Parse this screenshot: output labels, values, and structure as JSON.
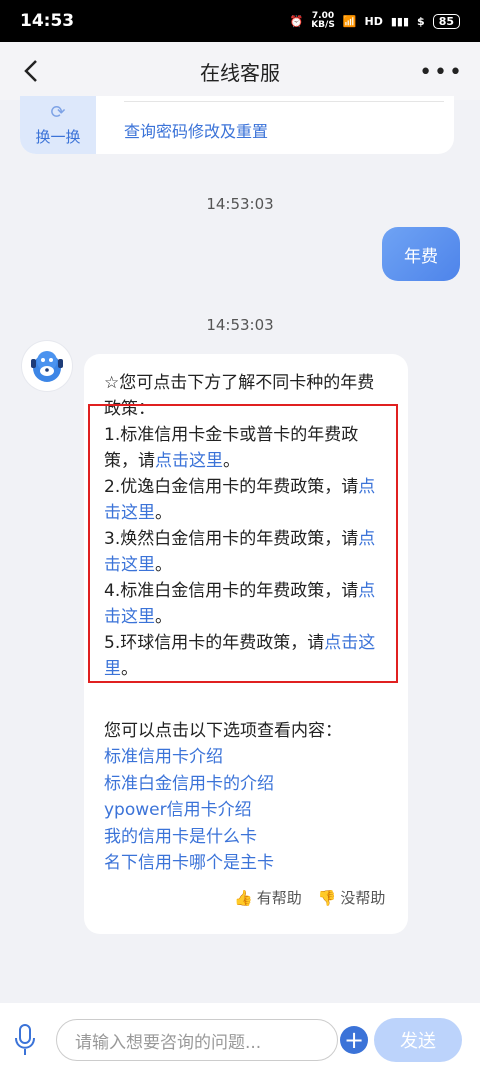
{
  "status": {
    "time": "14:53",
    "net_speed_top": "7.00",
    "net_speed_bottom": "KB/S",
    "battery": "85"
  },
  "nav": {
    "title": "在线客服",
    "more": "•••"
  },
  "top_card": {
    "swap_label": "换一换",
    "link": "查询密码修改及重置"
  },
  "times": [
    "14:53:03",
    "14:53:03"
  ],
  "user_msg": "年费",
  "bot": {
    "lines": [
      [
        "☆您可点击下方了解不同卡种的年费"
      ],
      [
        "政策："
      ],
      [
        "1.标准信用卡金卡或普卡的年费政"
      ],
      [
        "策，请",
        "点击这里",
        "。"
      ],
      [
        "2.优逸白金信用卡的年费政策，请",
        "点"
      ],
      [
        "击这里",
        "。"
      ],
      [
        "3.焕然白金信用卡的年费政策，请",
        "点"
      ],
      [
        "击这里",
        "。"
      ],
      [
        "4.标准白金信用卡的年费政策，请",
        "点"
      ],
      [
        "击这里",
        "。"
      ],
      [
        "5.环球信用卡的年费政策，请",
        "点击这"
      ],
      [
        "里",
        "。"
      ]
    ],
    "options_title": "您可以点击以下选项查看内容：",
    "options": [
      "标准信用卡介绍",
      "标准白金信用卡的介绍",
      "ypower信用卡介绍",
      "我的信用卡是什么卡",
      "名下信用卡哪个是主卡"
    ],
    "helpful": "有帮助",
    "not_helpful": "没帮助"
  },
  "input": {
    "placeholder": "请输入想要咨询的问题..."
  },
  "send_label": "发送"
}
